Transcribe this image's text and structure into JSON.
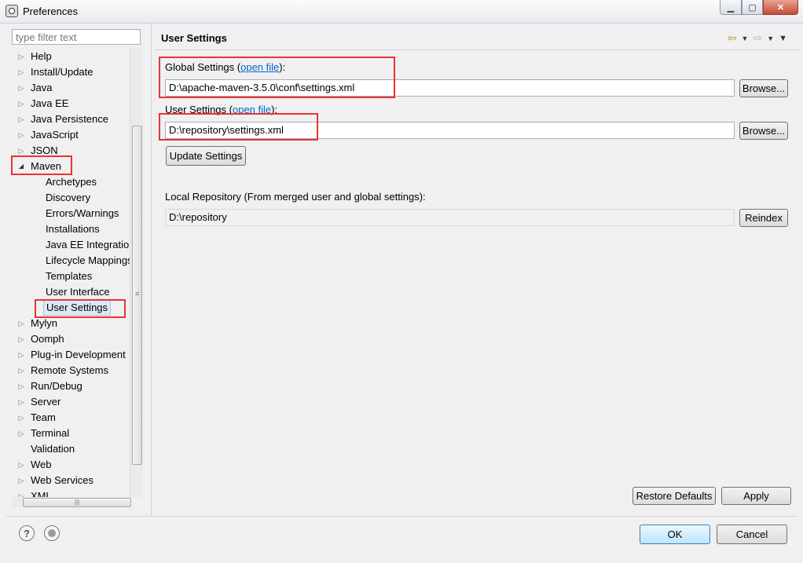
{
  "window": {
    "title": "Preferences"
  },
  "filter": {
    "placeholder": "type filter text"
  },
  "tree": {
    "items": [
      {
        "label": "Help",
        "expander": "collapsed",
        "level": 0
      },
      {
        "label": "Install/Update",
        "expander": "collapsed",
        "level": 0
      },
      {
        "label": "Java",
        "expander": "collapsed",
        "level": 0
      },
      {
        "label": "Java EE",
        "expander": "collapsed",
        "level": 0
      },
      {
        "label": "Java Persistence",
        "expander": "collapsed",
        "level": 0
      },
      {
        "label": "JavaScript",
        "expander": "collapsed",
        "level": 0
      },
      {
        "label": "JSON",
        "expander": "collapsed",
        "level": 0
      },
      {
        "label": "Maven",
        "expander": "expanded",
        "level": 0
      },
      {
        "label": "Archetypes",
        "expander": "none",
        "level": 1
      },
      {
        "label": "Discovery",
        "expander": "none",
        "level": 1
      },
      {
        "label": "Errors/Warnings",
        "expander": "none",
        "level": 1
      },
      {
        "label": "Installations",
        "expander": "none",
        "level": 1
      },
      {
        "label": "Java EE Integration",
        "expander": "none",
        "level": 1
      },
      {
        "label": "Lifecycle Mappings",
        "expander": "none",
        "level": 1
      },
      {
        "label": "Templates",
        "expander": "none",
        "level": 1
      },
      {
        "label": "User Interface",
        "expander": "none",
        "level": 1
      },
      {
        "label": "User Settings",
        "expander": "none",
        "level": 1,
        "selected": true
      },
      {
        "label": "Mylyn",
        "expander": "collapsed",
        "level": 0
      },
      {
        "label": "Oomph",
        "expander": "collapsed",
        "level": 0
      },
      {
        "label": "Plug-in Development",
        "expander": "collapsed",
        "level": 0
      },
      {
        "label": "Remote Systems",
        "expander": "collapsed",
        "level": 0
      },
      {
        "label": "Run/Debug",
        "expander": "collapsed",
        "level": 0
      },
      {
        "label": "Server",
        "expander": "collapsed",
        "level": 0
      },
      {
        "label": "Team",
        "expander": "collapsed",
        "level": 0
      },
      {
        "label": "Terminal",
        "expander": "collapsed",
        "level": 0
      },
      {
        "label": "Validation",
        "expander": "none",
        "level": 0
      },
      {
        "label": "Web",
        "expander": "collapsed",
        "level": 0
      },
      {
        "label": "Web Services",
        "expander": "collapsed",
        "level": 0
      },
      {
        "label": "XML",
        "expander": "collapsed",
        "level": 0
      }
    ]
  },
  "page": {
    "title": "User Settings",
    "global": {
      "label_prefix": "Global Settings (",
      "link": "open file",
      "label_suffix": "):",
      "value": "D:\\apache-maven-3.5.0\\conf\\settings.xml",
      "browse": "Browse..."
    },
    "user": {
      "label_prefix": "User Settings (",
      "link": "open file",
      "label_suffix": "):",
      "value": "D:\\repository\\settings.xml",
      "browse": "Browse..."
    },
    "update_button": "Update Settings",
    "local_repo": {
      "label": "Local Repository (From merged user and global settings):",
      "value": "D:\\repository",
      "reindex": "Reindex"
    },
    "restore_defaults": "Restore Defaults",
    "apply": "Apply"
  },
  "footer": {
    "ok": "OK",
    "cancel": "Cancel"
  },
  "colors": {
    "highlight": "#e53535",
    "link": "#0066cc",
    "selection": "#dde8f6"
  }
}
